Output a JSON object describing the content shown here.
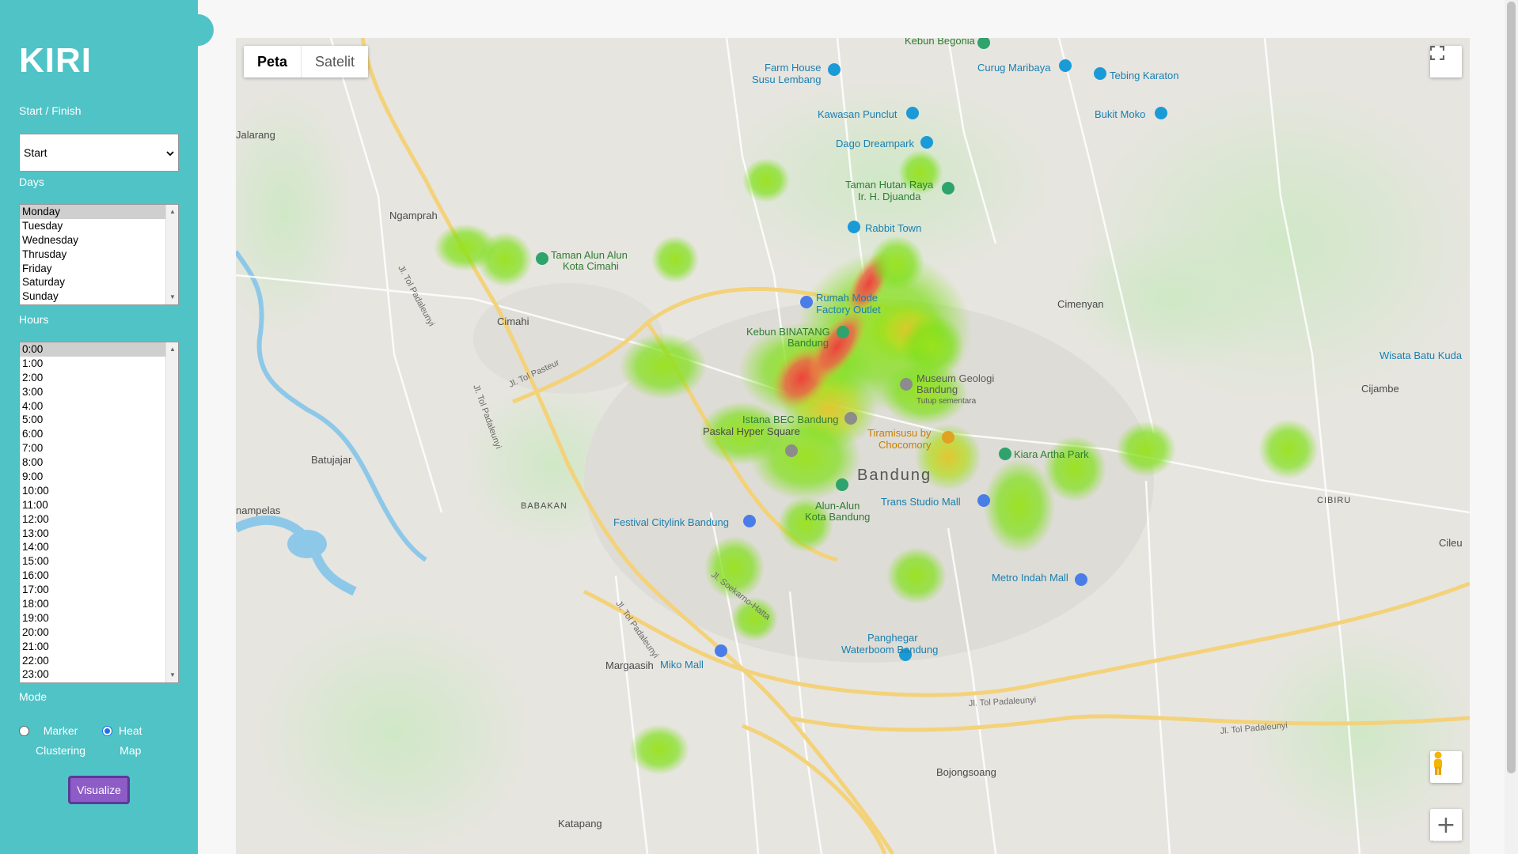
{
  "sidebar": {
    "brand": "KIRI",
    "start_finish_label": "Start / Finish",
    "start_select_value": "Start",
    "days_label": "Days",
    "days": [
      "Monday",
      "Tuesday",
      "Wednesday",
      "Thrusday",
      "Friday",
      "Saturday",
      "Sunday"
    ],
    "days_selected": "Monday",
    "hours_label": "Hours",
    "hours": [
      "0:00",
      "1:00",
      "2:00",
      "3:00",
      "4:00",
      "5:00",
      "6:00",
      "7:00",
      "8:00",
      "9:00",
      "10:00",
      "11:00",
      "12:00",
      "13:00",
      "14:00",
      "15:00",
      "16:00",
      "17:00",
      "18:00",
      "19:00",
      "20:00",
      "21:00",
      "22:00",
      "23:00"
    ],
    "hours_selected": "0:00",
    "mode_label": "Mode",
    "mode_options": [
      {
        "label_line1": "Marker",
        "label_line2": "Clustering",
        "checked": false
      },
      {
        "label_line1": "Heat",
        "label_line2": "Map",
        "checked": true
      }
    ],
    "visualize_label": "Visualize"
  },
  "map": {
    "map_type_options": [
      "Peta",
      "Satelit"
    ],
    "map_type_active": "Peta",
    "places": {
      "kebun_begonia": "Kebun Begonia",
      "farm_house_1": "Farm House",
      "farm_house_2": "Susu Lembang",
      "curug_maribaya": "Curug Maribaya",
      "tebing_karaton": "Tebing Karaton",
      "kawasan_punclut": "Kawasan Punclut",
      "bukit_moko": "Bukit Moko",
      "dago_dreampark": "Dago Dreampark",
      "taman_hutan_1": "Taman Hutan Raya",
      "taman_hutan_2": "Ir. H. Djuanda",
      "jalarang": "Jalarang",
      "ngamprah": "Ngamprah",
      "rabbit_town": "Rabbit Town",
      "taman_alun_1": "Taman Alun Alun",
      "taman_alun_2": "Kota Cimahi",
      "rumah_mode_1": "Rumah Mode",
      "rumah_mode_2": "Factory Outlet",
      "cimenyan": "Cimenyan",
      "cimahi": "Cimahi",
      "kebun_binatang_1": "Kebun BINATANG",
      "kebun_binatang_2": "Bandung",
      "museum_geologi_1": "Museum Geologi",
      "museum_geologi_2": "Bandung",
      "museum_geologi_3": "Tutup sementara",
      "wisata_batu": "Wisata Batu Kuda",
      "cijambe": "Cijambe",
      "istana_bec": "Istana BEC Bandung",
      "paskal": "Paskal Hyper Square",
      "tiramisusu_1": "Tiramisusu by",
      "tiramisusu_2": "Chocomory",
      "kiara_artha": "Kiara Artha Park",
      "batujajar": "Batujajar",
      "bandung": "Bandung",
      "trans_studio": "Trans Studio Mall",
      "babakan": "BABAKAN",
      "alun_alun_1": "Alun-Alun",
      "alun_alun_2": "Kota Bandung",
      "cibiru": "CIBIRU",
      "cileunyi": "Cileu",
      "nampelas": "nampelas",
      "festival_citylink": "Festival Citylink Bandung",
      "metro_indah": "Metro Indah Mall",
      "panghegar_1": "Panghegar",
      "panghegar_2": "Waterboom Bandung",
      "margaasih": "Margaasih",
      "miko_mall": "Miko Mall",
      "bojongsoang": "Bojongsoang",
      "katapang": "Katapang"
    },
    "roads": {
      "tol_pasteur": "Jl. Tol Pasteur",
      "tol_padaleunyi_w": "Jl. Tol Padaleunyi",
      "tol_padaleunyi_sw": "Jl. Tol Padaleunyi",
      "tol_padaleunyi_s": "Jl. Tol Padaleunyi",
      "tol_padaleunyi_se": "Jl. Tol Padaleunyi",
      "soekarno_hatta": "Jl. Soekarno-Hatta"
    }
  }
}
